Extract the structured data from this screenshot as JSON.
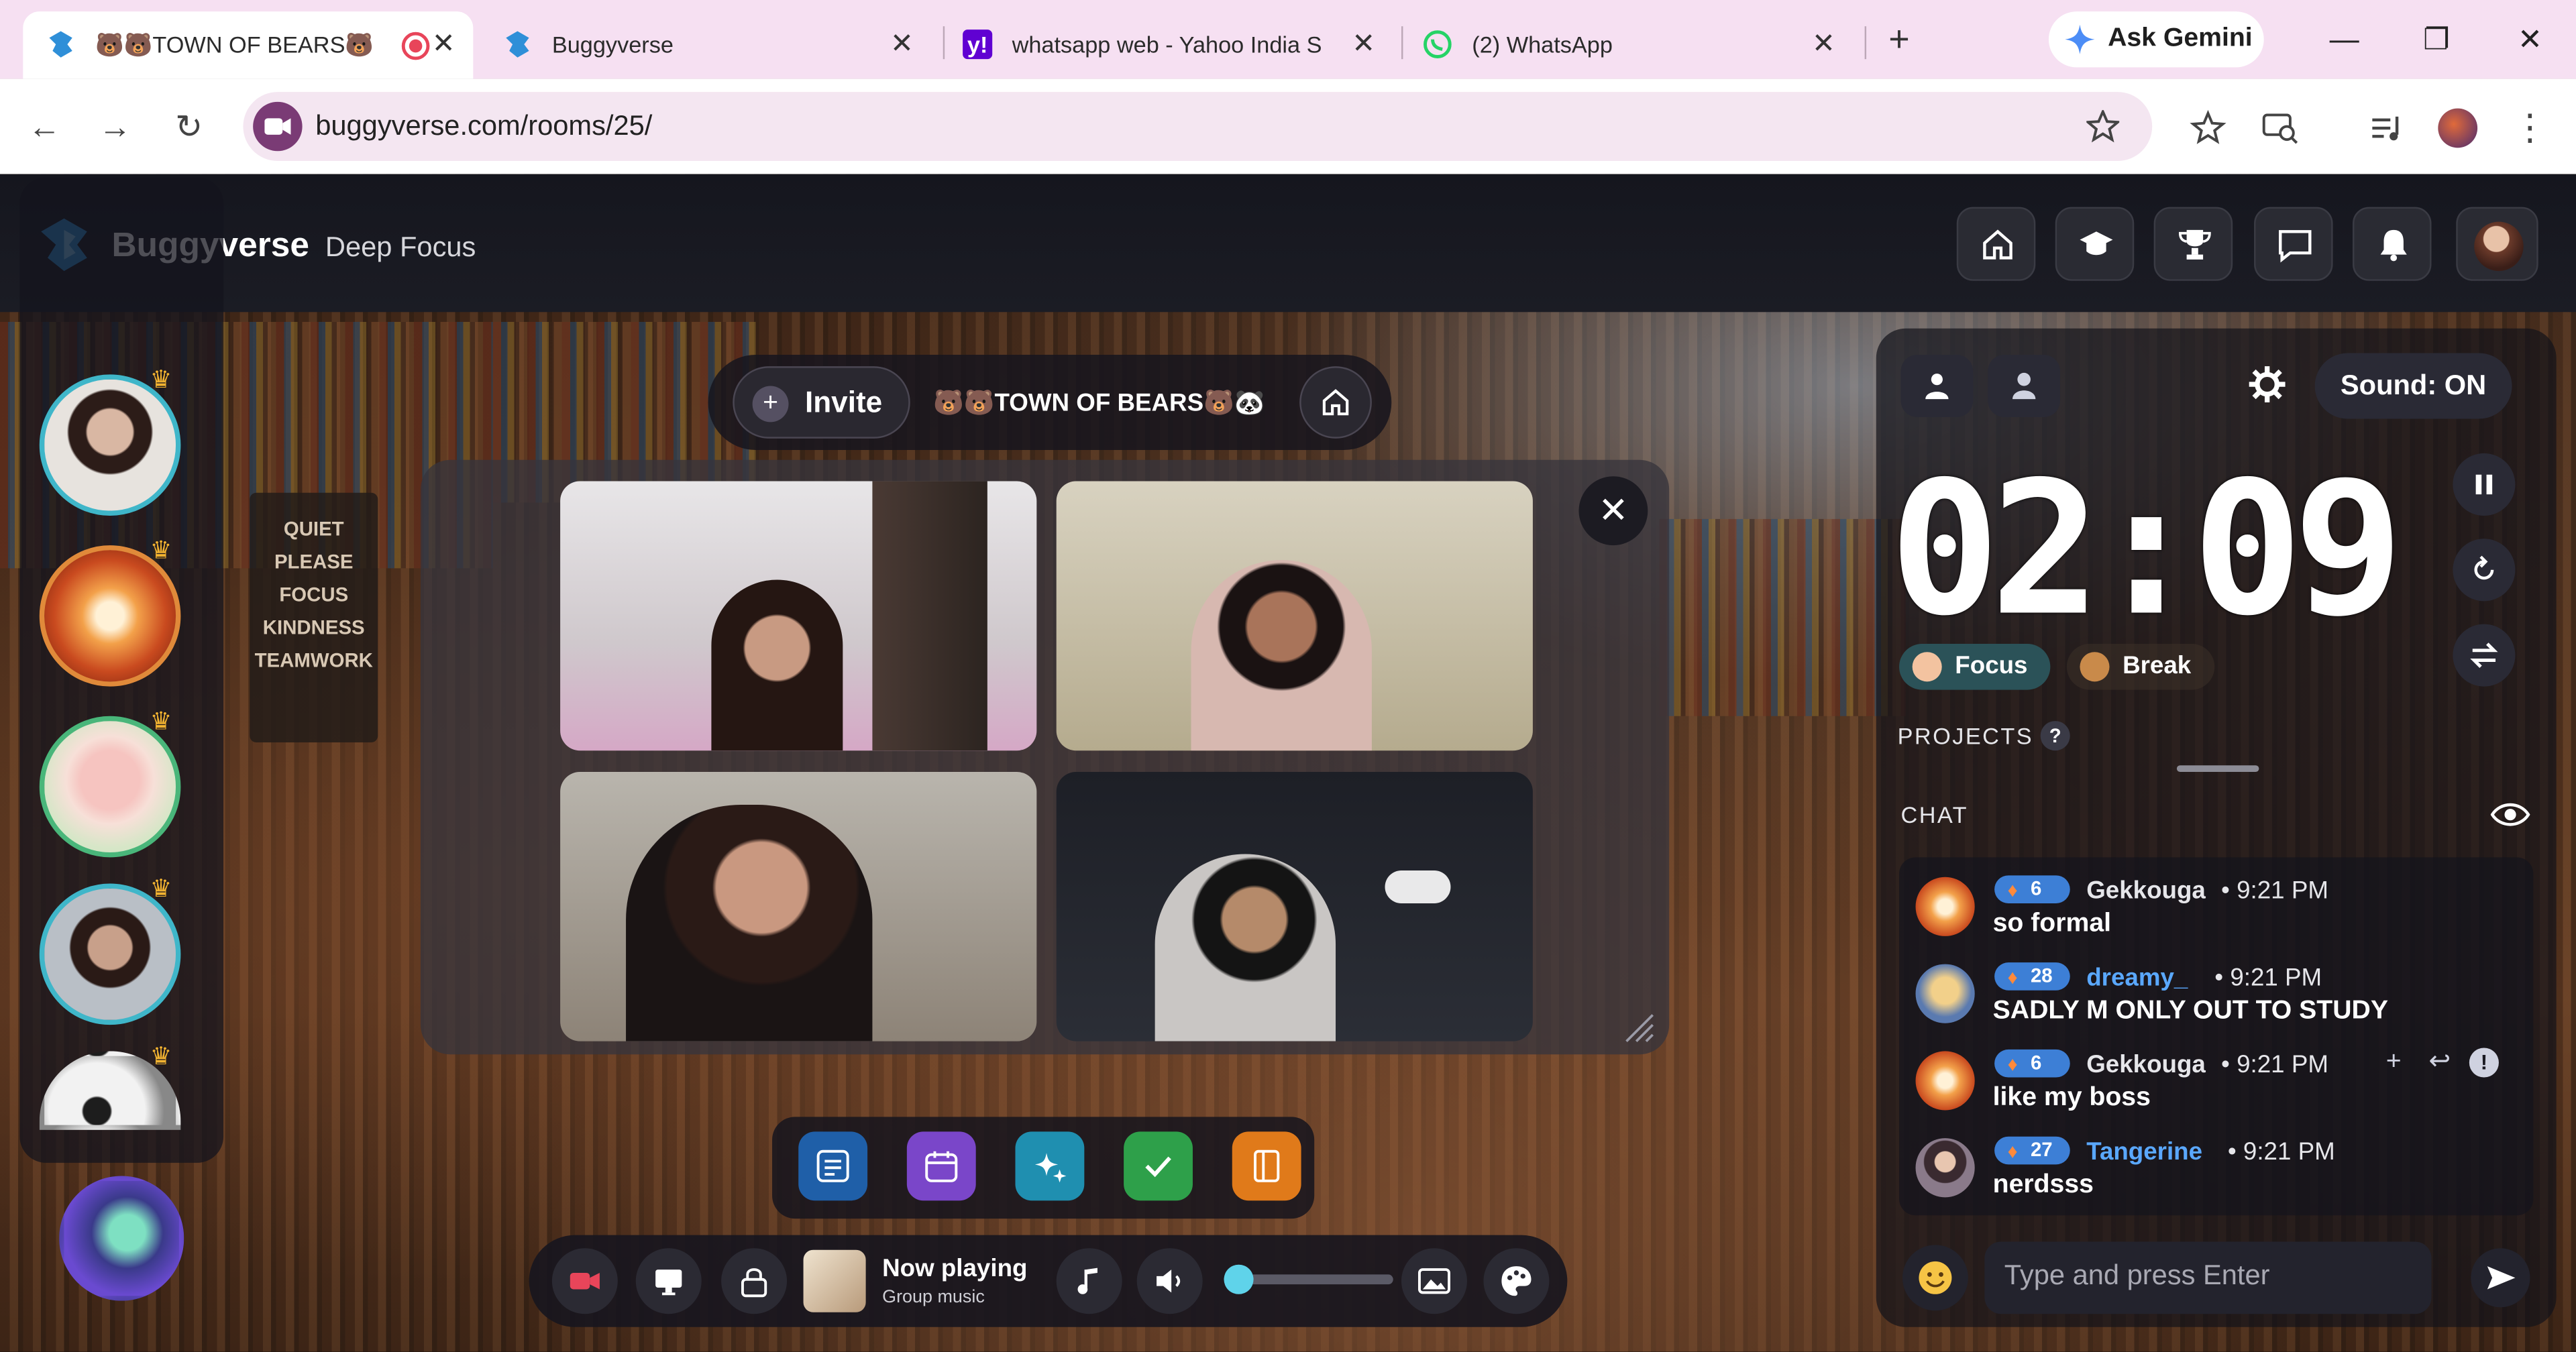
{
  "browser": {
    "tabs": [
      {
        "title": "🐻🐻TOWN OF BEARS🐻",
        "active": true
      },
      {
        "title": "Buggyverse",
        "active": false
      },
      {
        "title": "whatsapp web - Yahoo India S",
        "active": false
      },
      {
        "title": "(2) WhatsApp",
        "active": false
      }
    ],
    "new_tab": "+",
    "gemini_label": "Ask Gemini",
    "url": "buggyverse.com/rooms/25/"
  },
  "app": {
    "brand": "Buggyverse",
    "subtitle": "Deep Focus",
    "nav_icons": [
      "home-icon",
      "graduation-cap-icon",
      "trophy-icon",
      "chat-icon",
      "bell-icon"
    ]
  },
  "room": {
    "invite_label": "Invite",
    "name": "🐻🐻TOWN OF BEARS🐻🐼"
  },
  "signage": {
    "text": "QUIET PLEASE FOCUS KINDNESS TEAMWORK"
  },
  "player": {
    "now_playing": "Now playing",
    "source": "Group music",
    "volume": 0.02
  },
  "timer": {
    "sound_label": "Sound: ON",
    "time": "02:09",
    "focus_label": "Focus",
    "break_label": "Break",
    "projects_label": "PROJECTS",
    "help": "?"
  },
  "chat": {
    "label": "CHAT",
    "placeholder": "Type and press Enter",
    "messages": [
      {
        "streak": "6",
        "name": "Gekkouga",
        "time": "• 9:21 PM",
        "text": "so formal"
      },
      {
        "streak": "28",
        "name": "dreamy_",
        "time": "• 9:21 PM",
        "text": "SADLY M ONLY OUT TO STUDY"
      },
      {
        "streak": "6",
        "name": "Gekkouga",
        "time": "• 9:21 PM",
        "text": "like my boss"
      },
      {
        "streak": "27",
        "name": "Tangerine",
        "time": "• 9:21 PM",
        "text": "nerdsss"
      }
    ]
  },
  "colors": {
    "accent": "#3fb6c9",
    "username_blue": "#5aa8ff",
    "badge": "#3d7fd6",
    "record": "#e8455a"
  }
}
